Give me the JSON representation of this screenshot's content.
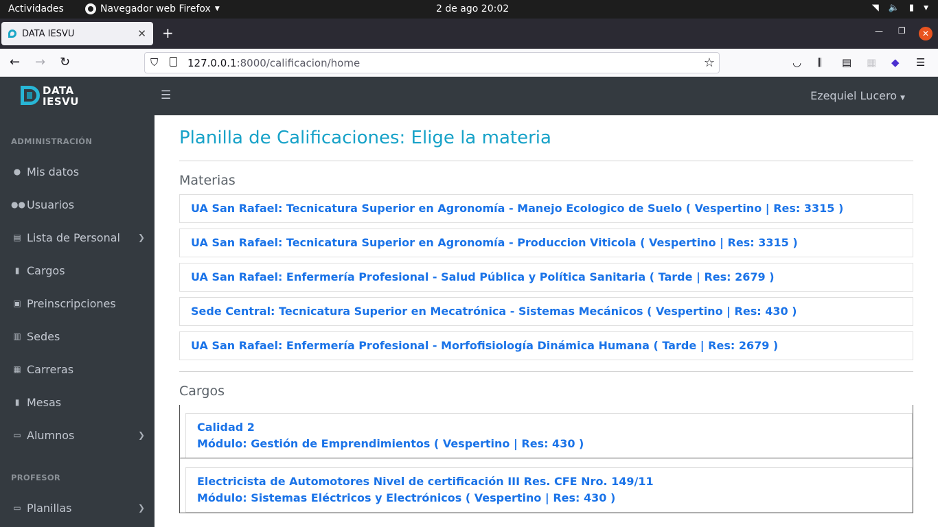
{
  "os": {
    "activities": "Actividades",
    "app_name": "Navegador web Firefox",
    "clock": "2 de ago  20:02"
  },
  "browser": {
    "tab_title": "DATA IESVU",
    "url_host": "127.0.0.1",
    "url_rest": ":8000/calificacion/home"
  },
  "sidebar": {
    "logo_line1": "DATA",
    "logo_line2": "IESVU",
    "section_admin": "ADMINISTRACIÓN",
    "section_prof": "PROFESOR",
    "items": [
      {
        "label": "Mis datos",
        "icon": "user-circle-icon"
      },
      {
        "label": "Usuarios",
        "icon": "users-icon"
      },
      {
        "label": "Lista de Personal",
        "icon": "clipboard-icon"
      },
      {
        "label": "Cargos",
        "icon": "file-icon"
      },
      {
        "label": "Preinscripciones",
        "icon": "id-card-icon"
      },
      {
        "label": "Sedes",
        "icon": "city-icon"
      },
      {
        "label": "Carreras",
        "icon": "building-icon"
      },
      {
        "label": "Mesas",
        "icon": "file-icon"
      },
      {
        "label": "Alumnos",
        "icon": "table-icon"
      },
      {
        "label": "Planillas",
        "icon": "table-icon"
      }
    ]
  },
  "header": {
    "user_name": "Ezequiel Lucero"
  },
  "main": {
    "title": "Planilla de Calificaciones: Elige la materia",
    "materias_heading": "Materias",
    "materias": [
      "UA San Rafael: Tecnicatura Superior en Agronomía - Manejo Ecologico de Suelo ( Vespertino | Res: 3315 )",
      "UA San Rafael: Tecnicatura Superior en Agronomía - Produccion Viticola ( Vespertino | Res: 3315 )",
      "UA San Rafael: Enfermería Profesional - Salud Pública y Política Sanitaria ( Tarde | Res: 2679 )",
      "Sede Central: Tecnicatura Superior en Mecatrónica - Sistemas Mecánicos ( Vespertino | Res: 430 )",
      "UA San Rafael: Enfermería Profesional - Morfofisiología Dinámica Humana ( Tarde | Res: 2679 )"
    ],
    "cargos_heading": "Cargos",
    "cargos": [
      {
        "line1": "Calidad 2",
        "line2": "Módulo: Gestión de Emprendimientos ( Vespertino | Res: 430 )"
      },
      {
        "line1": "Electricista de Automotores Nivel de certificación III Res. CFE Nro. 149/11",
        "line2": "Módulo: Sistemas Eléctricos y Electrónicos ( Vespertino | Res: 430 )"
      }
    ]
  }
}
